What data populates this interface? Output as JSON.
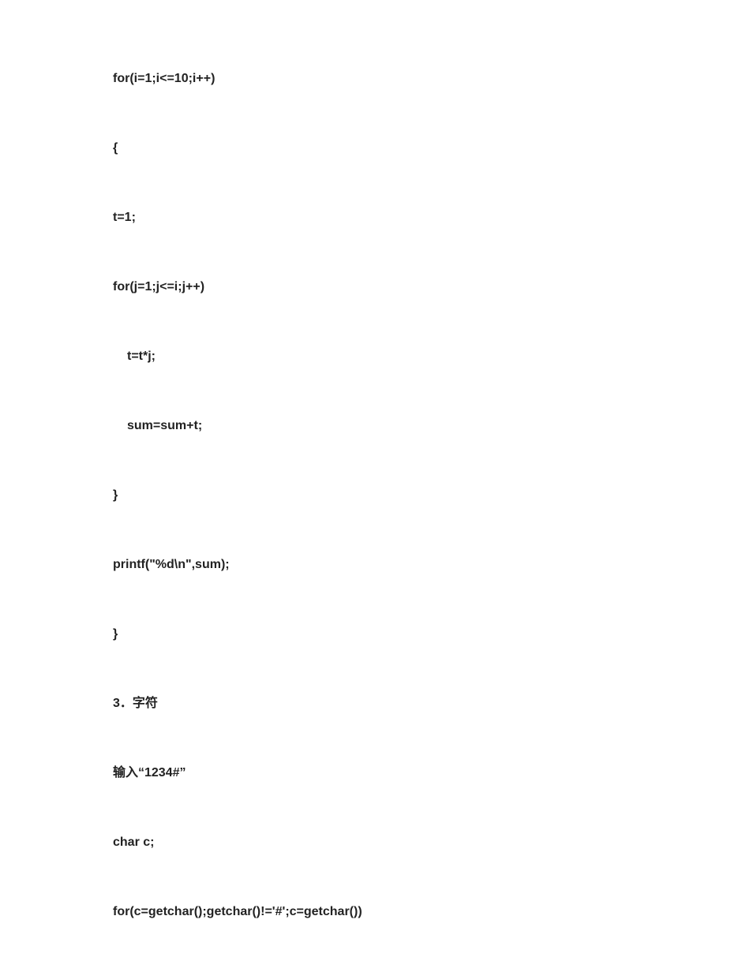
{
  "lines": {
    "l1": "for(i=1;i<=10;i++)",
    "l2": "{",
    "l3": "t=1;",
    "l4": "for(j=1;j<=i;j++)",
    "l5": "t=t*j;",
    "l6": "sum=sum+t;",
    "l7": "}",
    "l8": "printf(\"%d\\n\",sum);",
    "l9": "}",
    "l10": "3．字符",
    "l11": "输入“1234#”",
    "l12": "char c;",
    "l13": "for(c=getchar();getchar()!='#';c=getchar())"
  }
}
